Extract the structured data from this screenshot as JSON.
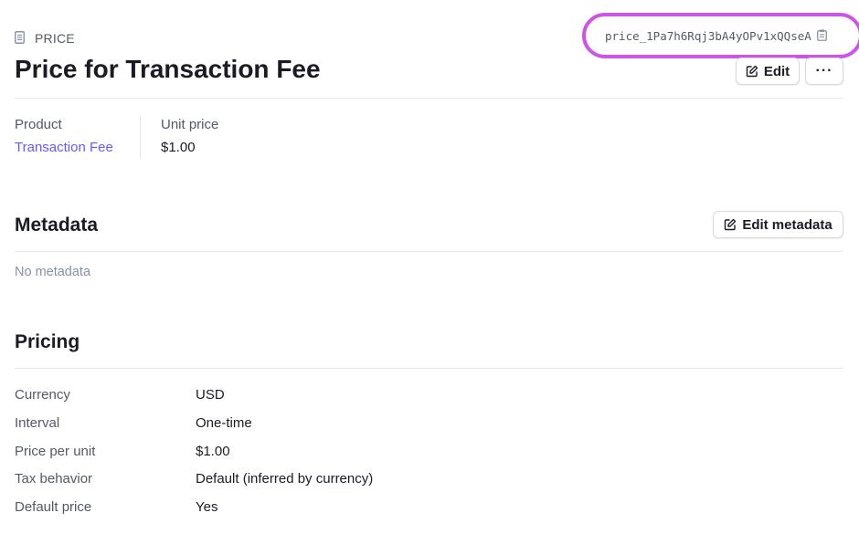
{
  "header": {
    "kind_label": "PRICE",
    "price_id": "price_1Pa7h6Rqj3bA4yOPv1xQQseA",
    "title": "Price for Transaction Fee",
    "edit_label": "Edit",
    "more_label": "···"
  },
  "summary": {
    "product_label": "Product",
    "product_value": "Transaction Fee",
    "unit_price_label": "Unit price",
    "unit_price_value": "$1.00"
  },
  "metadata": {
    "title": "Metadata",
    "edit_label": "Edit metadata",
    "empty_text": "No metadata"
  },
  "pricing": {
    "title": "Pricing",
    "rows": [
      {
        "key": "Currency",
        "value": "USD"
      },
      {
        "key": "Interval",
        "value": "One-time"
      },
      {
        "key": "Price per unit",
        "value": "$1.00"
      },
      {
        "key": "Tax behavior",
        "value": "Default (inferred by currency)"
      },
      {
        "key": "Default price",
        "value": "Yes"
      }
    ]
  },
  "colors": {
    "accent": "#635bff",
    "highlight": "#cc55e8",
    "muted": "#545969"
  },
  "icons": {
    "kind": "document-icon",
    "copy": "clipboard-icon",
    "edit": "pencil-square-icon"
  }
}
